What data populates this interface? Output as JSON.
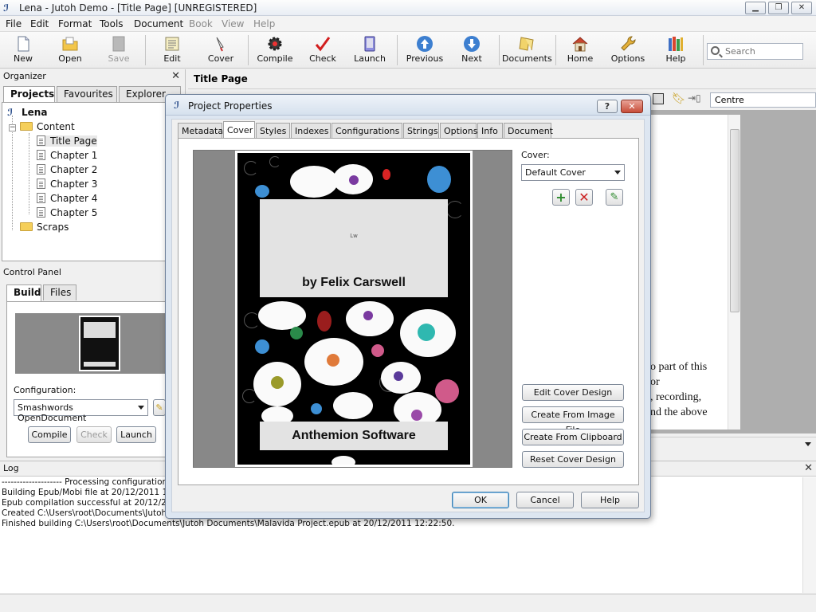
{
  "window": {
    "title": "Lena - Jutoh Demo - [Title Page] [UNREGISTERED]",
    "controls": [
      "minimize-icon",
      "maximize-icon",
      "close-icon"
    ]
  },
  "menu": [
    "File",
    "Edit",
    "Format",
    "Tools",
    "Document",
    "Book",
    "View",
    "Help"
  ],
  "toolbar": {
    "buttons": [
      {
        "label": "New",
        "icon": "new-document-icon",
        "enabled": true
      },
      {
        "label": "Open",
        "icon": "open-folder-icon",
        "enabled": true
      },
      {
        "label": "Save",
        "icon": "save-icon",
        "enabled": false
      },
      {
        "label": "Edit",
        "icon": "edit-icon",
        "enabled": true
      },
      {
        "label": "Cover",
        "icon": "cover-icon",
        "enabled": true
      },
      {
        "label": "Compile",
        "icon": "compile-gear-icon",
        "enabled": true
      },
      {
        "label": "Check",
        "icon": "check-icon",
        "enabled": true
      },
      {
        "label": "Launch",
        "icon": "launch-icon",
        "enabled": true
      },
      {
        "label": "Previous",
        "icon": "previous-arrow-icon",
        "enabled": true
      },
      {
        "label": "Next",
        "icon": "next-arrow-icon",
        "enabled": true
      },
      {
        "label": "Documents",
        "icon": "documents-icon",
        "enabled": true
      },
      {
        "label": "Home",
        "icon": "home-icon",
        "enabled": true
      },
      {
        "label": "Options",
        "icon": "wrench-icon",
        "enabled": true
      },
      {
        "label": "Help",
        "icon": "help-books-icon",
        "enabled": true
      }
    ],
    "search_placeholder": "Search"
  },
  "organizer": {
    "title": "Organizer",
    "tabs": [
      "Projects",
      "Favourites",
      "Explorer"
    ],
    "active_tab": "Projects",
    "tree": {
      "root": "Lena",
      "content_folder": "Content",
      "pages": [
        "Title Page",
        "Chapter 1",
        "Chapter 2",
        "Chapter 3",
        "Chapter 4",
        "Chapter 5"
      ],
      "selected": "Title Page",
      "scraps_folder": "Scraps"
    }
  },
  "control_panel": {
    "title": "Control Panel",
    "tabs": [
      "Build",
      "Files"
    ],
    "active_tab": "Build",
    "configuration_label": "Configuration:",
    "configuration_value": "Smashwords OpenDocument",
    "buttons": {
      "compile": "Compile",
      "check": "Check",
      "launch": "Launch"
    }
  },
  "editor": {
    "tab_title": "Title Page",
    "alignment": "Centre",
    "visible_text": [
      "o part of this",
      "or",
      ", recording,",
      "nd the above"
    ]
  },
  "log": {
    "title": "Log",
    "lines": [
      "-------------------- Processing configuration",
      "Building Epub/Mobi file at 20/12/2011 12:2",
      "Epub compilation successful at 20/12/2011",
      "Created C:\\Users\\root\\Documents\\Jutoh D",
      "Finished building C:\\Users\\root\\Documents\\Jutoh Documents\\Malavida Project.epub at 20/12/2011 12:22:50."
    ]
  },
  "dialog": {
    "title": "Project Properties",
    "help_btn": "?",
    "tabs": [
      "Metadata",
      "Cover",
      "Styles",
      "Indexes",
      "Configurations",
      "Strings",
      "Options",
      "Info",
      "Document"
    ],
    "active_tab": "Cover",
    "cover_label": "Cover:",
    "cover_value": "Default Cover",
    "cover_preview": {
      "author_line": "by Felix Carswell",
      "publisher": "Anthemion Software",
      "small_mark": "Lw"
    },
    "side_buttons": [
      "Edit Cover Design",
      "Create From Image File",
      "Create From Clipboard",
      "Reset Cover Design"
    ],
    "footer_buttons": {
      "ok": "OK",
      "cancel": "Cancel",
      "help": "Help"
    }
  },
  "colors": {
    "dialog_frame": "#dde6f1",
    "close_red": "#c74c38",
    "add_green": "#2e8b2e",
    "delete_red": "#cc2222"
  }
}
